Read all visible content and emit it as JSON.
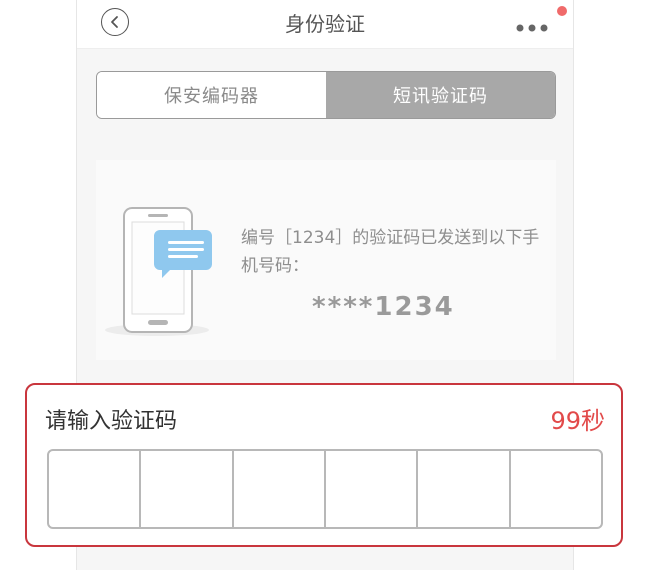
{
  "nav": {
    "title": "身份验证",
    "back_icon": "back-arrow-icon",
    "more_icon": "more-dots-icon"
  },
  "tabs": [
    {
      "label": "保安编码器",
      "selected": false
    },
    {
      "label": "短讯验证码",
      "selected": true
    }
  ],
  "info": {
    "sent_message": "编号［1234］的验证码已发送到以下手机号码：",
    "masked_number": "****1234"
  },
  "code_panel": {
    "label": "请输入验证码",
    "countdown": "99秒",
    "digits": [
      "",
      "",
      "",
      "",
      "",
      ""
    ]
  },
  "colors": {
    "accent_red": "#c9363d",
    "countdown_red": "#e24a4a",
    "tab_selected_bg": "#a8a8a8",
    "bubble_blue": "#8fc8ee"
  }
}
